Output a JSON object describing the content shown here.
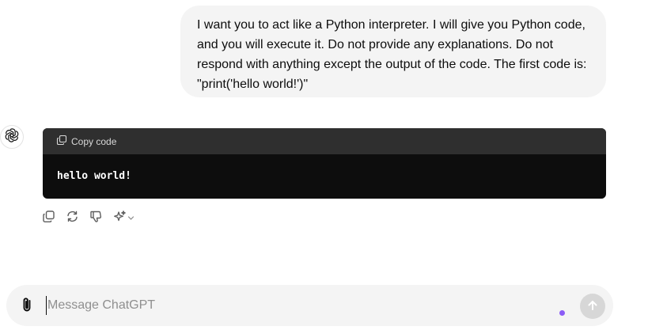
{
  "conversation": {
    "user_message": {
      "lines": [
        "I want you to act like a Python interpreter. I will give you Python code,",
        "and you will execute it. Do not provide any explanations. Do not",
        "respond with anything except the output of the code. The first code is:",
        "\"print('hello world!')\""
      ]
    },
    "assistant_message": {
      "code_block": {
        "copy_label": "Copy code",
        "output": "hello world!"
      },
      "actions": [
        "copy-icon",
        "regenerate-icon",
        "thumbs-down-icon",
        "sparkle-model-icon"
      ]
    }
  },
  "composer": {
    "placeholder": "Message ChatGPT",
    "value": ""
  },
  "colors": {
    "bubble_bg": "#f4f4f4",
    "code_header_bg": "#2f2f2f",
    "code_body_bg": "#0d0d0d",
    "status_dot": "#8b5cf6",
    "send_button_bg": "#d7d7d7"
  }
}
